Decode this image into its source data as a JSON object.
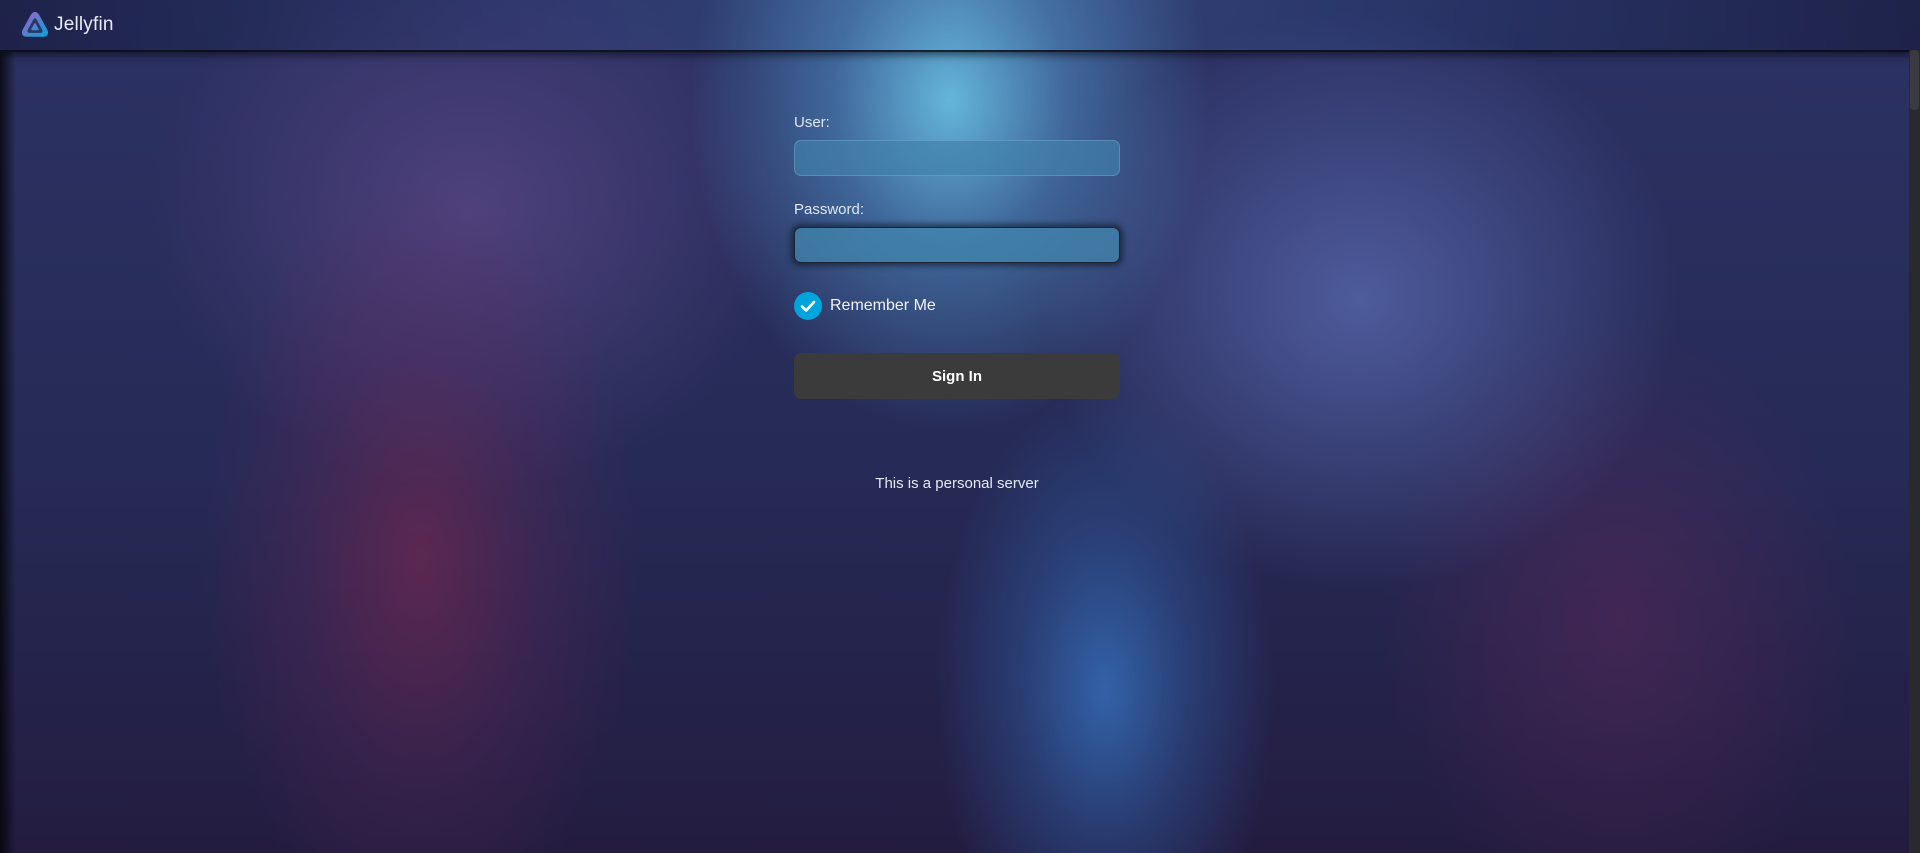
{
  "header": {
    "app_name": "Jellyfin",
    "logo_icon": "jellyfin-logo-icon"
  },
  "login": {
    "user_label": "User:",
    "user_value": "",
    "password_label": "Password:",
    "password_value": "",
    "remember_label": "Remember Me",
    "remember_checked": true,
    "signin_label": "Sign In",
    "disclaimer": "This is a personal server"
  },
  "colors": {
    "accent": "#00a4dc",
    "button_bg": "#3b3b3b",
    "logo_gradient_start": "#aa5cc3",
    "logo_gradient_end": "#00a4dc"
  }
}
